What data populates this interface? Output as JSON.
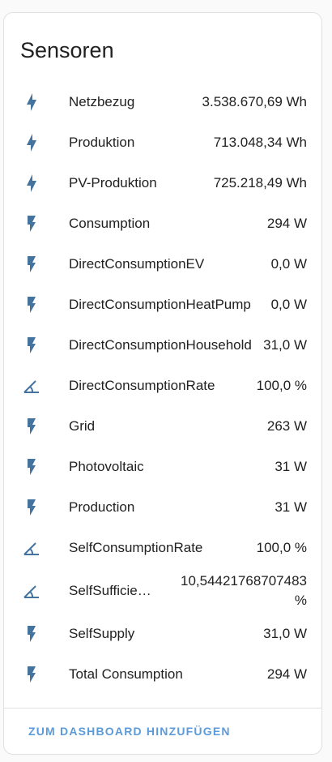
{
  "card": {
    "title": "Sensoren",
    "action_label": "ZUM DASHBOARD HINZUFÜGEN"
  },
  "colors": {
    "icon": "#44739e",
    "accent": "#5c9bd9",
    "text": "#212121"
  },
  "sensors": [
    {
      "name": "Netzbezug",
      "value": "3.538.670,69 Wh",
      "icon": "lightning-bolt-icon"
    },
    {
      "name": "Produktion",
      "value": "713.048,34 Wh",
      "icon": "lightning-bolt-icon"
    },
    {
      "name": "PV-Produktion",
      "value": "725.218,49 Wh",
      "icon": "lightning-bolt-icon"
    },
    {
      "name": "Consumption",
      "value": "294 W",
      "icon": "flash-icon"
    },
    {
      "name": "DirectConsumptionEV",
      "value": "0,0 W",
      "icon": "flash-icon"
    },
    {
      "name": "DirectConsumptionHeatPump",
      "value": "0,0 W",
      "icon": "flash-icon"
    },
    {
      "name": "DirectConsumptionHousehold",
      "value": "31,0 W",
      "icon": "flash-icon"
    },
    {
      "name": "DirectConsumptionRate",
      "value": "100,0 %",
      "icon": "angle-acute-icon"
    },
    {
      "name": "Grid",
      "value": "263 W",
      "icon": "flash-icon"
    },
    {
      "name": "Photovoltaic",
      "value": "31 W",
      "icon": "flash-icon"
    },
    {
      "name": "Production",
      "value": "31 W",
      "icon": "flash-icon"
    },
    {
      "name": "SelfConsumptionRate",
      "value": "100,0 %",
      "icon": "angle-acute-icon"
    },
    {
      "name": "SelfSufficiency",
      "value": "10,54421768707483 %",
      "icon": "angle-acute-icon"
    },
    {
      "name": "SelfSupply",
      "value": "31,0 W",
      "icon": "flash-icon"
    },
    {
      "name": "Total Consumption",
      "value": "294 W",
      "icon": "flash-icon"
    }
  ]
}
